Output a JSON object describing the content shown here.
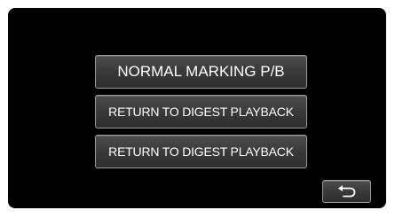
{
  "menu": {
    "items": [
      {
        "label": "NORMAL MARKING P/B"
      },
      {
        "label": "RETURN TO DIGEST PLAYBACK"
      },
      {
        "label": "RETURN TO DIGEST PLAYBACK"
      }
    ]
  },
  "footer": {
    "back_icon": "return-arrow-icon"
  },
  "colors": {
    "screen_background": "#000000",
    "button_background": "#3a3a3a",
    "button_border": "#9a9a9a",
    "text": "#ffffff"
  }
}
